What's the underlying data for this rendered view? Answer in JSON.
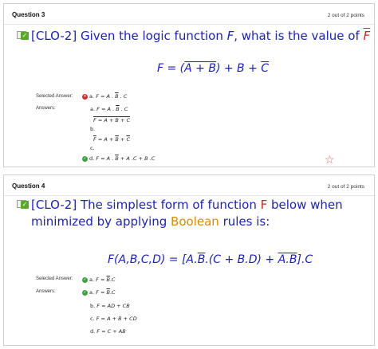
{
  "q3": {
    "title": "Question 3",
    "points": "2 out of 2 points",
    "question": {
      "prefix": "[CLO-2] Given the logic function ",
      "var": "F",
      "mid": ", what is the value of ",
      "target": "F"
    },
    "formula": {
      "lhs": "F = (",
      "ab": "A + B",
      "rhs": ") + B + ",
      "c": "C"
    },
    "selected_label": "Selected Answer:",
    "answers_label": "Answers:",
    "selected": {
      "letter": "a.",
      "text": "F = A . B . C"
    },
    "options": [
      {
        "letter": "a.",
        "text": "F = A . B . C"
      },
      {
        "letter": "b.",
        "text": "F = A + B + C"
      },
      {
        "letter": "c.",
        "text": "F = A + B + C"
      },
      {
        "letter": "d.",
        "text": "F = A . B + A . C + B . C"
      }
    ],
    "star_icon": "☆"
  },
  "q4": {
    "title": "Question 4",
    "points": "2 out of 2 points",
    "question": {
      "prefix": "[CLO-2] The simplest form of function ",
      "var": "F",
      "mid": " below when",
      "line2_prefix": "minimized by applying ",
      "boolean": "Boolean",
      "line2_suffix": " rules is:"
    },
    "formula": {
      "lhs": "F(A,B,C,D) = [A.",
      "b": "B",
      "mid": ".(C + B.D) + ",
      "ab": "A.B",
      "end": "].C"
    },
    "selected_label": "Selected Answer:",
    "answers_label": "Answers:",
    "selected": {
      "letter": "a.",
      "text": "F = B.C"
    },
    "options": [
      {
        "letter": "a.",
        "text": "F = B.C"
      },
      {
        "letter": "b.",
        "text": "F = AD + CB"
      },
      {
        "letter": "c.",
        "text": "F = A + B + CD"
      },
      {
        "letter": "d.",
        "text": "F = C + AB"
      }
    ]
  }
}
